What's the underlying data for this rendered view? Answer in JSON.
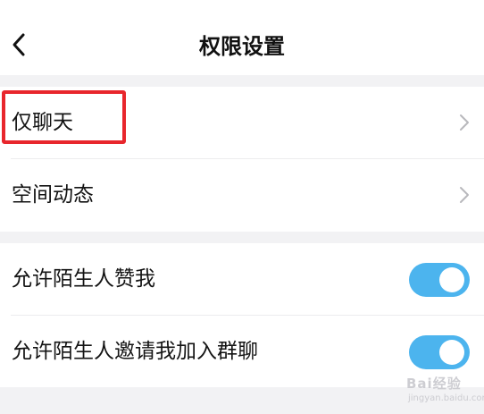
{
  "header": {
    "title": "权限设置",
    "back_icon": "chevron-left-icon"
  },
  "settings": {
    "groups": [
      {
        "items": [
          {
            "label": "仅聊天",
            "control": "chevron"
          },
          {
            "label": "空间动态",
            "control": "chevron"
          }
        ]
      },
      {
        "items": [
          {
            "label": "允许陌生人赞我",
            "control": "toggle",
            "enabled": true
          },
          {
            "label": "允许陌生人邀请我加入群聊",
            "control": "toggle",
            "enabled": true
          }
        ]
      }
    ]
  },
  "annotation": {
    "highlight_color": "#e8262c"
  },
  "watermark": {
    "brand": "Bai经验",
    "url": "jingyan.baidu.com"
  },
  "colors": {
    "toggle_on": "#4cb4ee",
    "page_background": "#f2f2f4",
    "card_background": "#ffffff"
  }
}
